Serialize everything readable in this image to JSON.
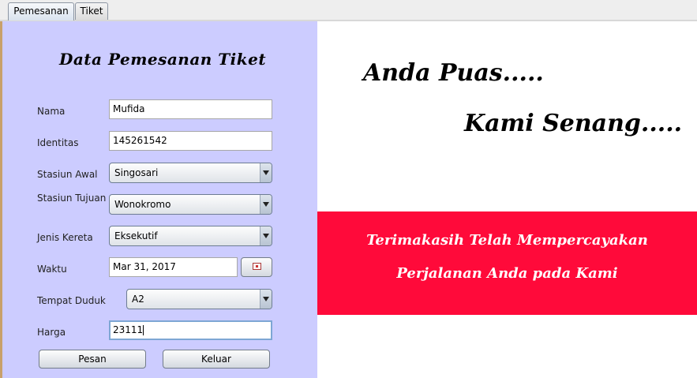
{
  "tabs": [
    {
      "label": "Pemesanan",
      "active": true
    },
    {
      "label": "Tiket",
      "active": false
    }
  ],
  "form": {
    "title": "Data Pemesanan Tiket",
    "fields": {
      "nama": {
        "label": "Nama",
        "value": "Mufida"
      },
      "identitas": {
        "label": "Identitas",
        "value": "145261542"
      },
      "stasiun_awal": {
        "label": "Stasiun Awal",
        "value": "Singosari"
      },
      "stasiun_tujuan": {
        "label": "Stasiun Tujuan",
        "value": "Wonokromo"
      },
      "jenis_kereta": {
        "label": "Jenis Kereta",
        "value": "Eksekutif"
      },
      "waktu": {
        "label": "Waktu",
        "value": "Mar 31, 2017"
      },
      "tempat_duduk": {
        "label": "Tempat Duduk",
        "value": "A2"
      },
      "harga": {
        "label": "Harga",
        "value": "23111"
      }
    },
    "buttons": {
      "pesan": "Pesan",
      "keluar": "Keluar"
    }
  },
  "message": {
    "line1": "Anda Puas.....",
    "line2": "Kami Senang.....",
    "banner_line1": "Terimakasih Telah Mempercayakan",
    "banner_line2": "Perjalanan Anda pada Kami"
  },
  "icons": {
    "date_picker": "calendar-icon",
    "dropdown": "chevron-down-icon"
  },
  "colors": {
    "form_bg": "#ccccff",
    "banner_bg": "#ff0a3a",
    "banner_text": "#ffffff"
  }
}
